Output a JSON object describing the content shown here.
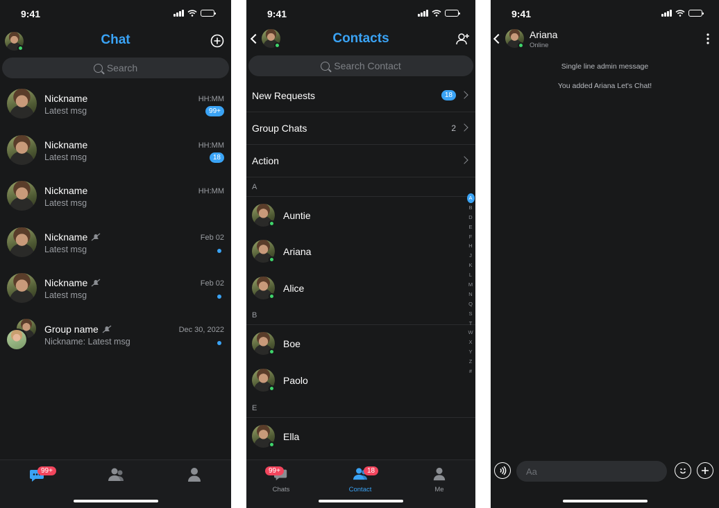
{
  "status_time": "9:41",
  "chat_screen": {
    "title": "Chat",
    "search_placeholder": "Search",
    "conversations": [
      {
        "name": "Nickname",
        "message": "Latest msg",
        "time": "HH:MM",
        "badge": "99+",
        "muted": false
      },
      {
        "name": "Nickname",
        "message": "Latest msg",
        "time": "HH:MM",
        "badge": "18",
        "muted": false
      },
      {
        "name": "Nickname",
        "message": "Latest msg",
        "time": "HH:MM",
        "badge": "",
        "muted": false
      },
      {
        "name": "Nickname",
        "message": "Latest msg",
        "time": "Feb 02",
        "badge": "",
        "muted": true
      },
      {
        "name": "Nickname",
        "message": "Latest msg",
        "time": "Feb 02",
        "badge": "",
        "muted": true
      },
      {
        "name": "Group name",
        "message": "Nickname: Latest msg",
        "time": "Dec 30, 2022",
        "badge": "",
        "muted": true
      }
    ],
    "tab_badge": "99+"
  },
  "contacts_screen": {
    "title": "Contacts",
    "search_placeholder": "Search Contact",
    "menu": [
      {
        "label": "New Requests",
        "badge": "18",
        "count": ""
      },
      {
        "label": "Group Chats",
        "badge": "",
        "count": "2"
      },
      {
        "label": "Action",
        "badge": "",
        "count": ""
      }
    ],
    "sections": [
      {
        "letter": "A",
        "contacts": [
          "Auntie",
          "Ariana",
          "Alice"
        ]
      },
      {
        "letter": "B",
        "contacts": [
          "Boe",
          "Paolo"
        ]
      },
      {
        "letter": "E",
        "contacts": [
          "Ella"
        ]
      }
    ],
    "alphabet": [
      "A",
      "B",
      "D",
      "E",
      "F",
      "H",
      "J",
      "K",
      "L",
      "M",
      "N",
      "Q",
      "S",
      "T",
      "W",
      "X",
      "Y",
      "Z",
      "#"
    ],
    "tabs": [
      {
        "label": "Chats",
        "badge": "99+"
      },
      {
        "label": "Contact",
        "badge": "18"
      },
      {
        "label": "Me",
        "badge": ""
      }
    ]
  },
  "conversation_screen": {
    "contact_name": "Ariana",
    "contact_status": "Online",
    "system_messages": [
      "Single line admin message",
      "You added  Ariana  Let's Chat!"
    ],
    "input_placeholder": "Aa"
  },
  "colors": {
    "accent": "#3aa3f5",
    "background": "#18191a",
    "badge_red": "#f2455d",
    "online": "#3fd46b"
  }
}
